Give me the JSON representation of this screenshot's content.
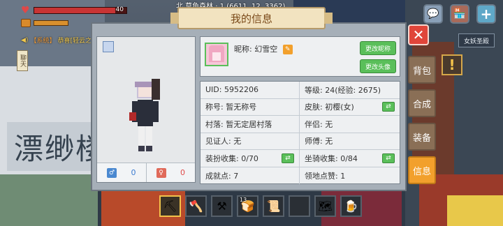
{
  "hud": {
    "hp_value": "40",
    "hp_fraction": 0.88,
    "location": "北 草鱼森林 · 1 (6611, 12, 3362)",
    "system_message_tag": "【系统】",
    "system_message": "恭喜[轻云之月]的刨世灭魂率领的队伍成功击败了冥界女神海拉",
    "left_tab": "聊天",
    "server_label": "女妖圣殿"
  },
  "icons": {
    "chat": "chat-icon",
    "shop": "shop-icon",
    "plus": "plus-icon",
    "close": "close-icon",
    "hint": "exclamation-icon"
  },
  "side_tabs": [
    {
      "label": "背包",
      "active": false
    },
    {
      "label": "合成",
      "active": false
    },
    {
      "label": "装备",
      "active": false
    },
    {
      "label": "信息",
      "active": true
    }
  ],
  "hotbar": {
    "slots": [
      {
        "item": "pickaxe-icon",
        "glyph": "⛏",
        "count": "",
        "selected": true
      },
      {
        "item": "axe-icon",
        "glyph": "🪓",
        "count": "",
        "selected": false
      },
      {
        "item": "shovel-icon",
        "glyph": "⚒",
        "count": "",
        "selected": false
      },
      {
        "item": "bread-icon",
        "glyph": "🍞",
        "count": "13",
        "selected": false
      },
      {
        "item": "scroll-icon",
        "glyph": "📜",
        "count": "",
        "selected": false
      },
      {
        "item": "empty-slot",
        "glyph": "",
        "count": "",
        "selected": false
      },
      {
        "item": "map-icon",
        "glyph": "🗺",
        "count": "",
        "selected": false
      },
      {
        "item": "drink-icon",
        "glyph": "🍺",
        "count": "",
        "selected": false
      }
    ]
  },
  "panel": {
    "title": "我的信息",
    "nickname_label": "昵称:",
    "nickname": "幻雪空",
    "change_nickname": "更改昵称",
    "change_avatar": "更改头像",
    "follow_count": "0",
    "fan_count": "0",
    "info": [
      {
        "text": "UID: 5952206",
        "action": ""
      },
      {
        "text": "等级: 24(经验: 2675)",
        "action": ""
      },
      {
        "text": "称号: 暂无称号",
        "action": ""
      },
      {
        "text": "皮肤: 初樱(女)",
        "action": "swap"
      },
      {
        "text": "村落: 暂无定居村落",
        "action": ""
      },
      {
        "text": "伴侣: 无",
        "action": ""
      },
      {
        "text": "见证人: 无",
        "action": ""
      },
      {
        "text": "师傅: 无",
        "action": ""
      },
      {
        "text": "装扮收集: 0/70",
        "action": "swap"
      },
      {
        "text": "坐骑收集: 0/84",
        "action": "swap"
      },
      {
        "text": "成就点: 7",
        "action": ""
      },
      {
        "text": "领地点赞: 1",
        "action": ""
      }
    ]
  },
  "watermark": "漂缈楼",
  "colors": {
    "accent_orange": "#f2a02c",
    "button_green": "#5abf5a",
    "close_red": "#e0453a",
    "hp_red": "#c83434"
  }
}
